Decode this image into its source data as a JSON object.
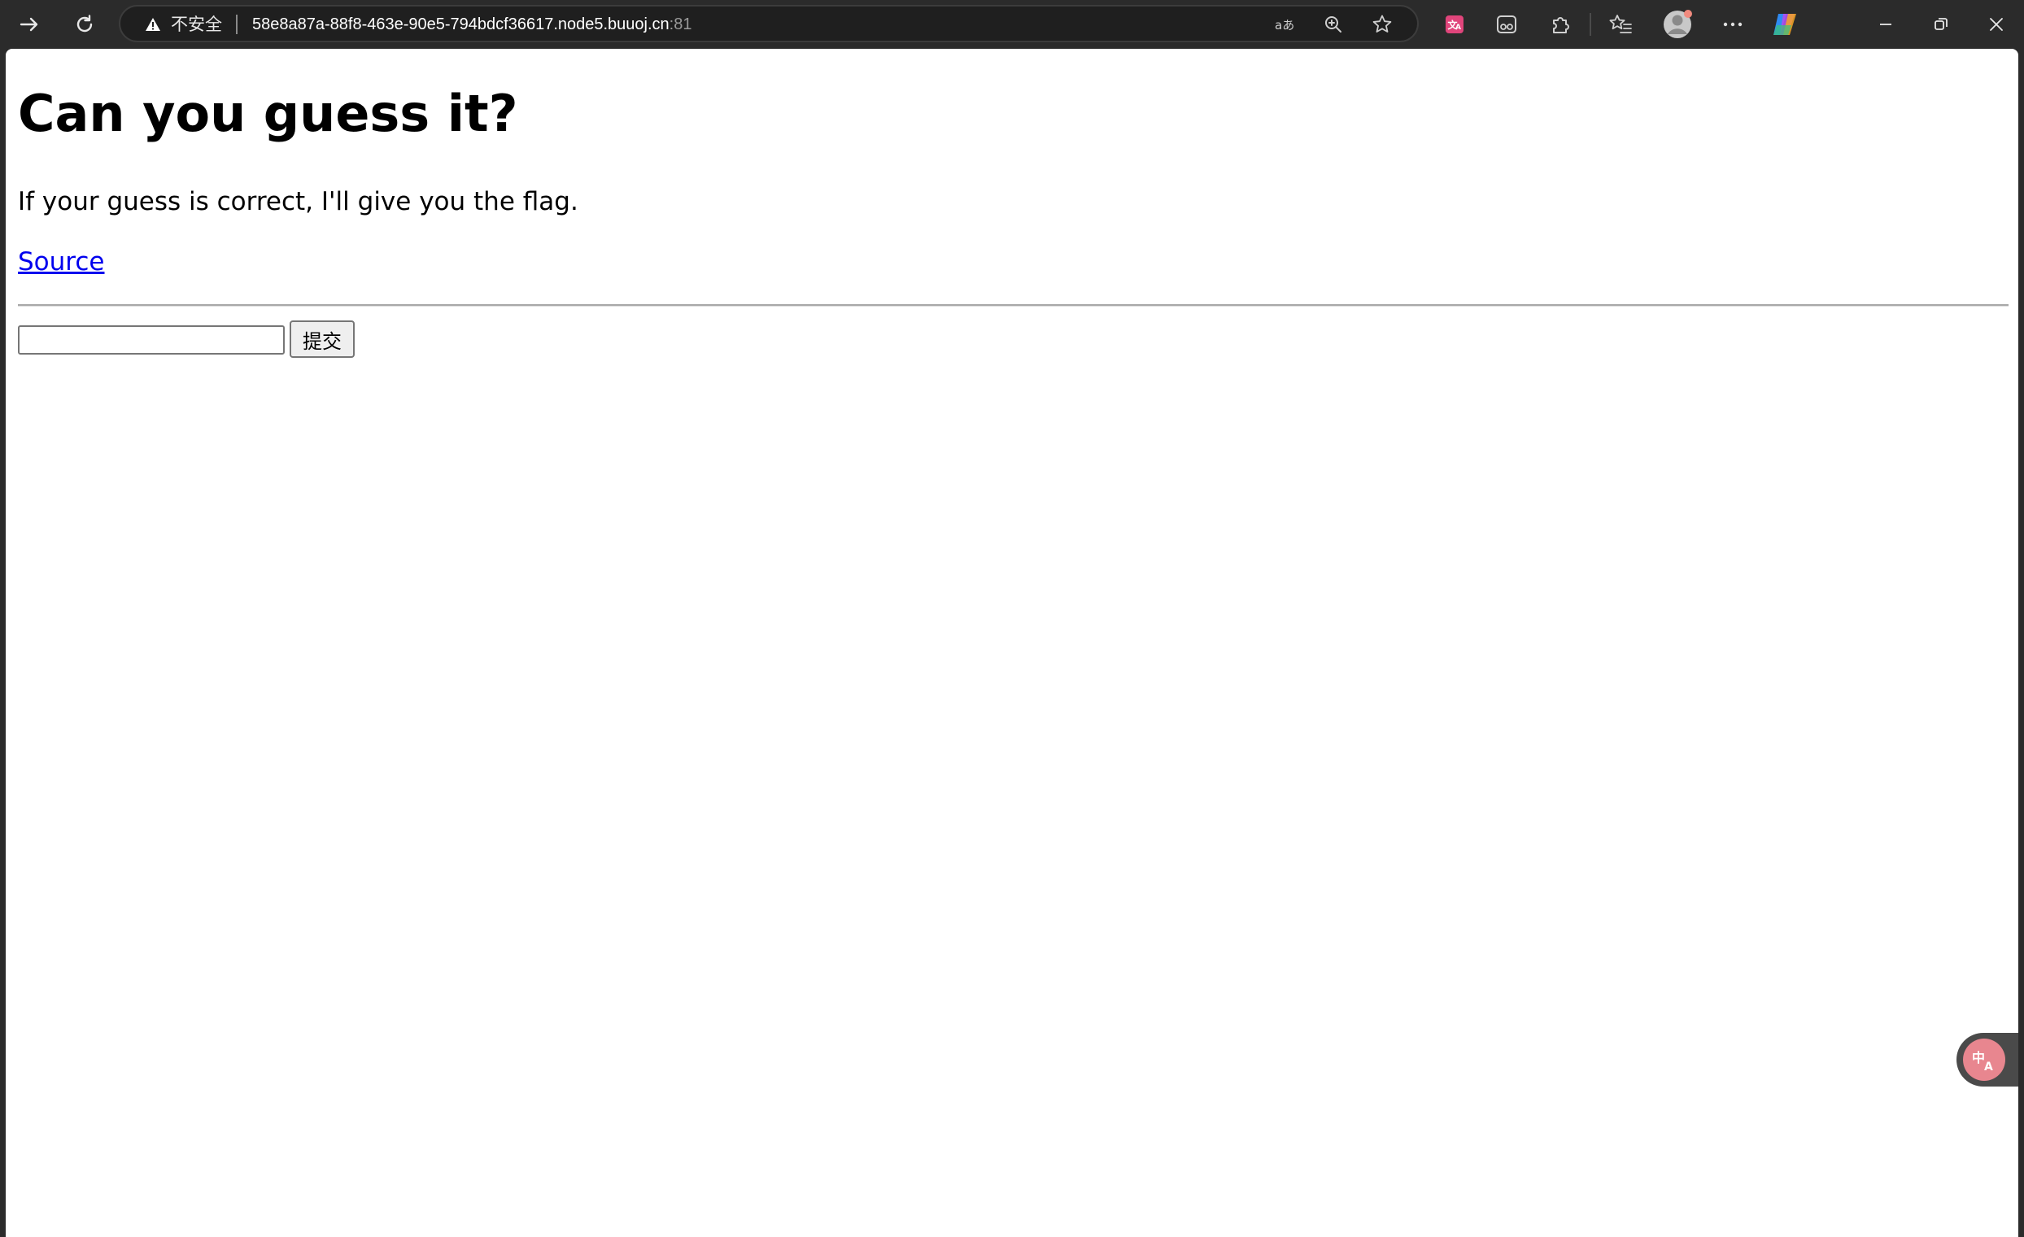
{
  "browser": {
    "security_label": "不安全",
    "url_host": "58e8a87a-88f8-463e-90e5-794bdcf36617.node5.buuoj.cn",
    "url_port": ":81",
    "icons": {
      "forward": "arrow-right-icon",
      "reload": "reload-icon",
      "security": "warning-triangle-icon",
      "read_aloud": "read-aloud-icon",
      "zoom": "zoom-icon",
      "favorite": "star-icon",
      "translate_ext": "translate-extension-icon",
      "reading_mode": "immersive-reader-icon",
      "extensions": "puzzle-icon",
      "favorites": "favorites-icon",
      "profile": "avatar-icon",
      "more": "ellipsis-icon",
      "copilot": "copilot-icon",
      "minimize": "minimize-icon",
      "restore": "restore-icon",
      "close": "close-icon"
    },
    "colors": {
      "chrome_bg": "#2b2b2b",
      "address_bg": "#1f1f1f",
      "translate_pink": "#e8868f"
    }
  },
  "page": {
    "title": "Can you guess it?",
    "description": "If your guess is correct, I'll give you the flag.",
    "source_link": "Source",
    "form": {
      "input_value": "",
      "submit_label": "提交"
    },
    "colors": {
      "link": "#0000ee"
    }
  }
}
